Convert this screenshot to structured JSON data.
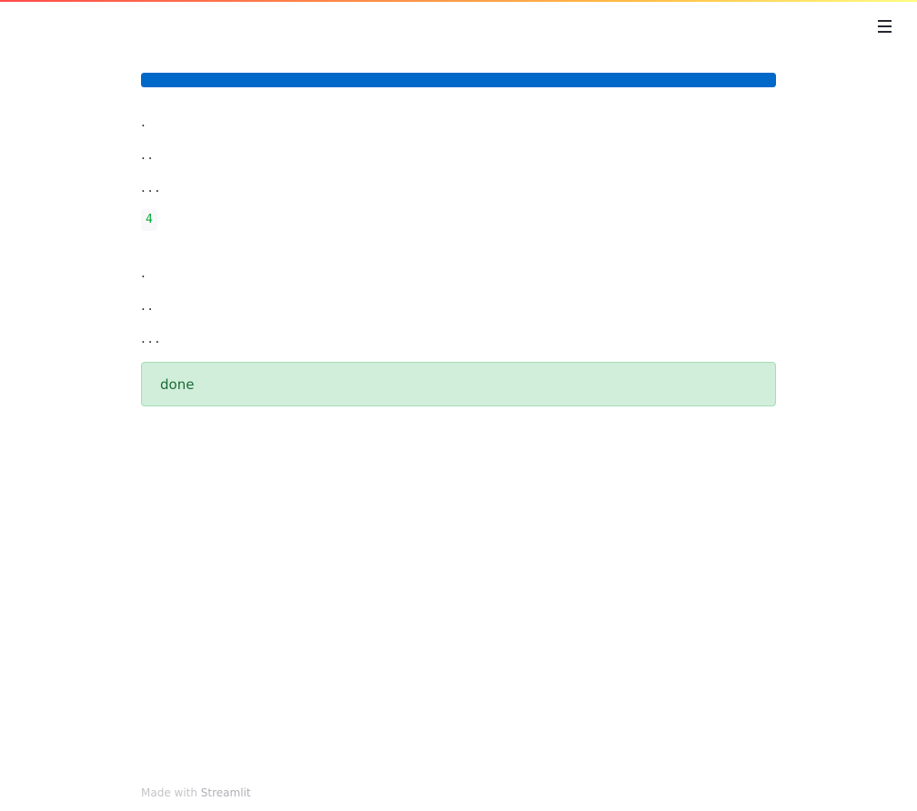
{
  "header": {
    "menu_icon": "hamburger-menu-icon"
  },
  "progress": {
    "value": 1.0,
    "color": "#0068c9"
  },
  "output": {
    "dots_1": ".",
    "dots_2": "..",
    "dots_3": "...",
    "code_value": "4",
    "dots_4": ".",
    "dots_5": "..",
    "dots_6": "..."
  },
  "alert": {
    "text": "done",
    "type": "success"
  },
  "footer": {
    "prefix": "Made with ",
    "brand": "Streamlit"
  },
  "colors": {
    "accent": "#0068c9",
    "success_bg": "#d0eed9",
    "success_text": "#1b6b36"
  }
}
